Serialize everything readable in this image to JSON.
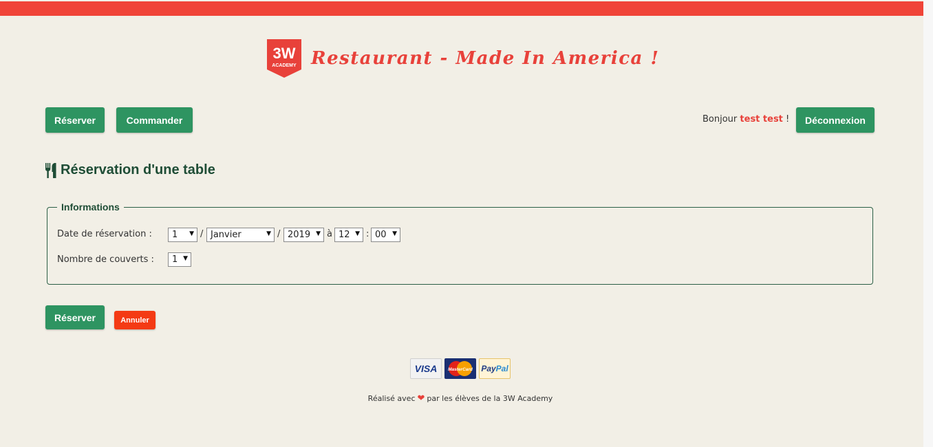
{
  "header": {
    "logo_text": "3W",
    "logo_subtext": "ACADEMY",
    "site_title": "Restaurant - Made In America !"
  },
  "nav": {
    "reserve_label": "Réserver",
    "order_label": "Commander",
    "greeting_prefix": "Bonjour",
    "user_name": "test test",
    "greeting_suffix": "!",
    "logout_label": "Déconnexion"
  },
  "page": {
    "title": "Réservation d'une table",
    "title_icon": "utensils-icon"
  },
  "form": {
    "legend": "Informations",
    "date_label": "Date de réservation :",
    "day": "1",
    "month": "Janvier",
    "year": "2019",
    "separator_slash": "/",
    "at_label": "à",
    "hour": "12",
    "colon": ":",
    "minute": "00",
    "covers_label": "Nombre de couverts :",
    "covers": "1",
    "submit_label": "Réserver",
    "cancel_label": "Annuler"
  },
  "payments": {
    "visa": "VISA",
    "mastercard": "MasterCard",
    "paypal_part1": "Pay",
    "paypal_part2": "Pal"
  },
  "footer": {
    "text_before": "Réalisé avec",
    "text_after": "par les élèves de la 3W Academy",
    "heart_icon": "heart-icon"
  },
  "colors": {
    "accent_red": "#e8413a",
    "primary_green": "#2e9461",
    "danger_red": "#f43a14",
    "background": "#f2efe6"
  }
}
